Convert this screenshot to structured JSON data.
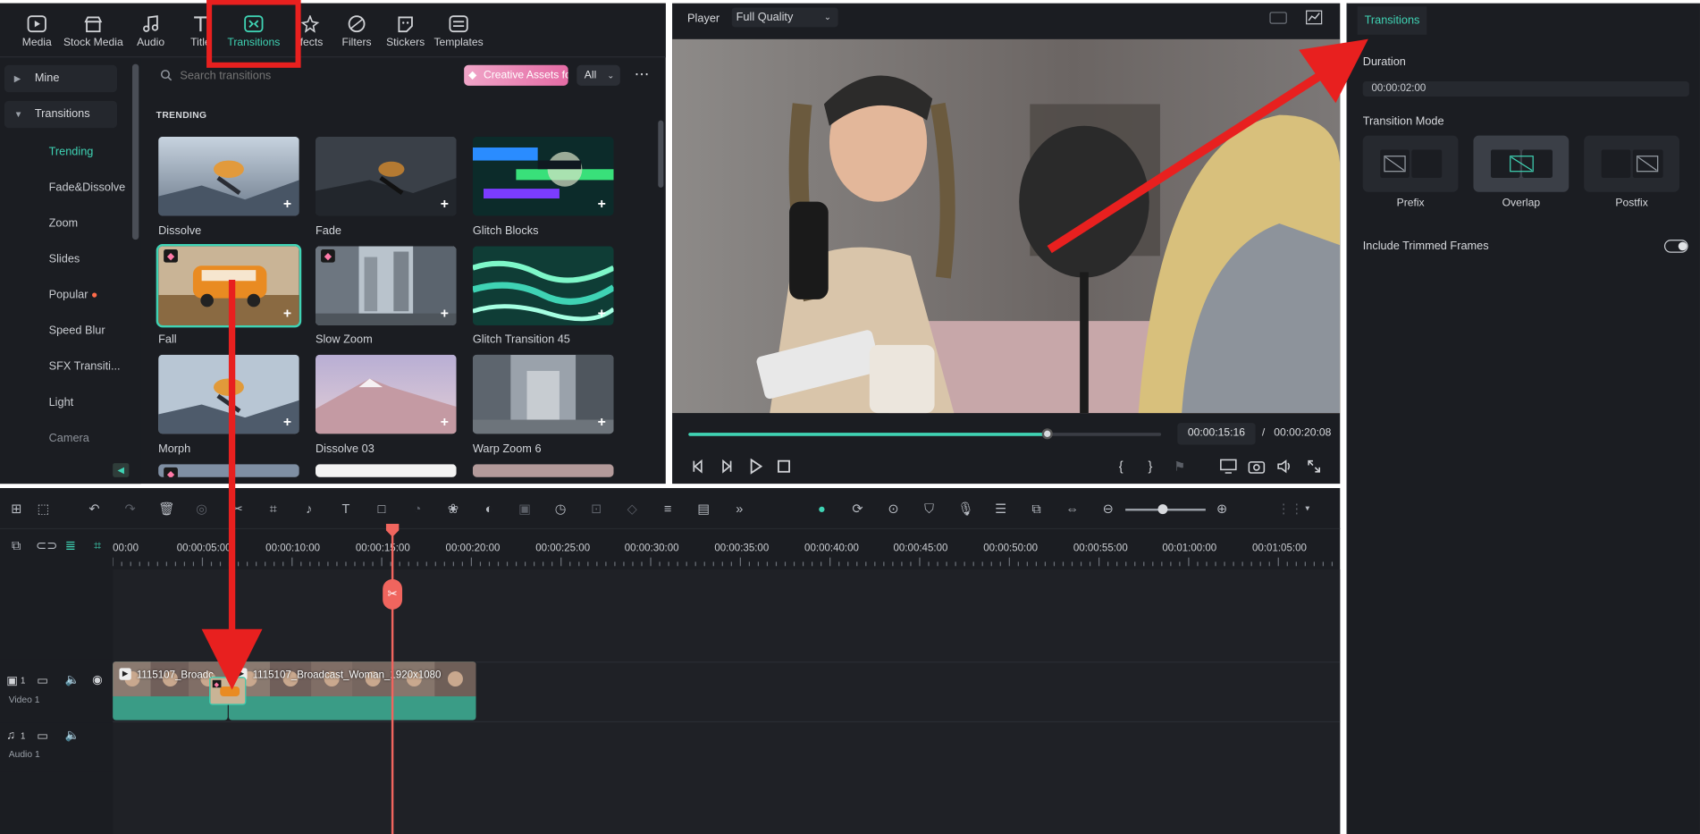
{
  "toolbar": {
    "tabs": [
      {
        "label": "Media",
        "icon": "media-icon"
      },
      {
        "label": "Stock Media",
        "icon": "stock-media-icon"
      },
      {
        "label": "Audio",
        "icon": "music-note-icon"
      },
      {
        "label": "Titles",
        "icon": "title-t-icon"
      },
      {
        "label": "Transitions",
        "icon": "transitions-icon"
      },
      {
        "label": "Effects",
        "icon": "effects-icon"
      },
      {
        "label": "Filters",
        "icon": "filters-icon"
      },
      {
        "label": "Stickers",
        "icon": "stickers-icon"
      },
      {
        "label": "Templates",
        "icon": "templates-icon"
      }
    ],
    "visible_labels": [
      "Media",
      "Stock Media",
      "Audio",
      "Title",
      "Transitions",
      "ffects",
      "Filters",
      "Stickers",
      "Templates"
    ],
    "active": "Transitions"
  },
  "sidebar": {
    "groups": [
      {
        "label": "Mine",
        "expanded": false
      },
      {
        "label": "Transitions",
        "expanded": true
      }
    ],
    "items": [
      "Trending",
      "Fade&Dissolve",
      "Zoom",
      "Slides",
      "Popular",
      "Speed Blur",
      "SFX Transiti...",
      "Light",
      "Camera"
    ],
    "active_item": "Trending"
  },
  "search": {
    "placeholder": "Search transitions",
    "creative_assets": "Creative Assets fo",
    "filter": "All",
    "more": "⋯"
  },
  "section_title": "TRENDING",
  "transitions": [
    {
      "name": "Dissolve",
      "premium": false,
      "selected": false
    },
    {
      "name": "Fade",
      "premium": false,
      "selected": false
    },
    {
      "name": "Glitch Blocks",
      "premium": false,
      "selected": false
    },
    {
      "name": "Fall",
      "premium": true,
      "selected": true
    },
    {
      "name": "Slow Zoom",
      "premium": true,
      "selected": false
    },
    {
      "name": "Glitch Transition 45",
      "premium": false,
      "selected": false
    },
    {
      "name": "Morph",
      "premium": false,
      "selected": false
    },
    {
      "name": "Dissolve 03",
      "premium": false,
      "selected": false
    },
    {
      "name": "Warp Zoom 6",
      "premium": false,
      "selected": false
    }
  ],
  "player": {
    "title": "Player",
    "quality": "Full Quality",
    "progress": 0.76,
    "current_time": "00:00:15:16",
    "separator": "/",
    "total_time": "00:00:20:08",
    "controls": [
      "step-back-icon",
      "play-frame-icon",
      "play-icon",
      "stop-icon"
    ],
    "mark_in": "{",
    "mark_out": "}"
  },
  "properties": {
    "tab": "Transitions",
    "duration_label": "Duration",
    "duration_value": "00:00:02:00",
    "mode_label": "Transition Mode",
    "modes": [
      "Prefix",
      "Overlap",
      "Postfix"
    ],
    "active_mode": "Overlap",
    "include_label": "Include Trimmed Frames",
    "include_on": false
  },
  "timeline": {
    "ruler": [
      "00:00",
      "00:00:05:00",
      "00:00:10:00",
      "00:00:15:00",
      "00:00:20:00",
      "00:00:25:00",
      "00:00:30:00",
      "00:00:35:00",
      "00:00:40:00",
      "00:00:45:00",
      "00:00:50:00",
      "00:00:55:00",
      "00:01:00:00",
      "00:01:05:00"
    ],
    "tracks": [
      {
        "name": "Video 1",
        "index": "1"
      },
      {
        "name": "Audio 1",
        "index": "1"
      }
    ],
    "clips": [
      {
        "name": "1115107_Broadc"
      },
      {
        "name": "1115107_Broadcast_Woman_1920x1080"
      }
    ]
  },
  "colors": {
    "accent": "#3fd3b4",
    "annotation": "#e8201f",
    "playhead": "#f0655e",
    "panel": "#1b1d22"
  }
}
